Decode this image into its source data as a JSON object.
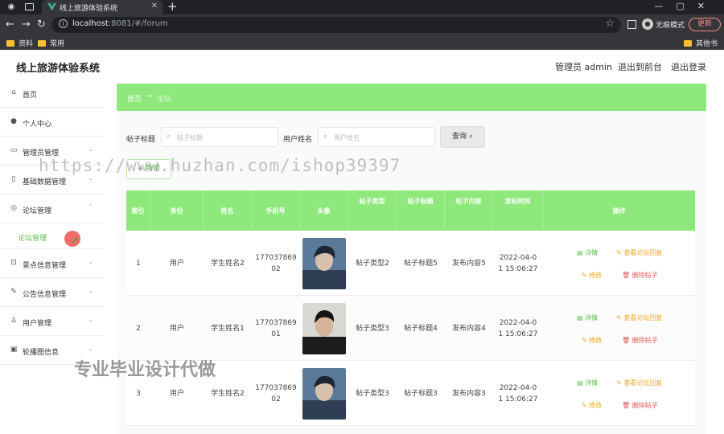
{
  "browser": {
    "tab_title": "线上旅游体验系统",
    "url_host": "localhost",
    "url_rest": ":8081/#/forum",
    "profile_label": "无痕模式",
    "update_label": "更新",
    "bookmarks": [
      "资料",
      "常用",
      "其他书签"
    ]
  },
  "app": {
    "title": "线上旅游体验系统",
    "admin_label": "管理员 admin",
    "back_front_label": "退出到前台",
    "logout_label": "退出登录"
  },
  "sidebar": {
    "items": [
      {
        "label": "首页",
        "icon": "home-icon"
      },
      {
        "label": "个人中心",
        "icon": "user-icon"
      },
      {
        "label": "管理员管理",
        "icon": "admin-icon"
      },
      {
        "label": "基础数据管理",
        "icon": "data-icon"
      },
      {
        "label": "论坛管理",
        "icon": "forum-icon"
      },
      {
        "label": "论坛管理",
        "icon": "",
        "sub": true
      },
      {
        "label": "景点信息管理",
        "icon": "scenic-icon"
      },
      {
        "label": "公告信息管理",
        "icon": "notice-icon"
      },
      {
        "label": "用户管理",
        "icon": "users-icon"
      },
      {
        "label": "轮播图信息",
        "icon": "carousel-icon"
      }
    ]
  },
  "breadcrumb": {
    "home": "首页",
    "current": "论坛"
  },
  "search": {
    "title_label": "帖子标题",
    "title_placeholder": "帖子标题",
    "user_label": "用户姓名",
    "user_placeholder": "用户姓名",
    "search_button": "查询",
    "add_button": "新增"
  },
  "table": {
    "headers": [
      "索引",
      "身份",
      "姓名",
      "手机号",
      "头像",
      "帖子类型",
      "帖子标题",
      "帖子内容",
      "发帖时间",
      "操作"
    ],
    "rows": [
      {
        "index": "1",
        "role": "用户",
        "name": "学生姓名2",
        "phone": "17703786902",
        "type": "帖子类型2",
        "title": "帖子标题5",
        "content": "发布内容5",
        "time": "2022-04-01 15:06:27"
      },
      {
        "index": "2",
        "role": "用户",
        "name": "学生姓名1",
        "phone": "17703786901",
        "type": "帖子类型3",
        "title": "帖子标题4",
        "content": "发布内容4",
        "time": "2022-04-01 15:06:27"
      },
      {
        "index": "3",
        "role": "用户",
        "name": "学生姓名2",
        "phone": "17703786902",
        "type": "帖子类型3",
        "title": "帖子标题3",
        "content": "发布内容3",
        "time": "2022-04-01 15:06:27"
      }
    ],
    "actions": {
      "detail": "详情",
      "view_reply": "查看论坛回复",
      "edit": "修改",
      "delete": "删除帖子"
    }
  },
  "watermarks": {
    "url": "https://www.huzhan.com/ishop39397",
    "slogan": "专业毕业设计代做"
  }
}
